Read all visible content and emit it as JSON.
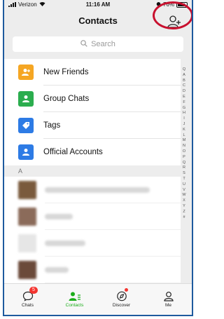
{
  "status": {
    "carrier": "Verizon",
    "time": "11:16 AM",
    "battery": "76%"
  },
  "nav": {
    "title": "Contacts"
  },
  "search": {
    "placeholder": "Search"
  },
  "menu": [
    {
      "label": "New Friends",
      "color": "#f5a623",
      "icon": "new-friends-icon"
    },
    {
      "label": "Group Chats",
      "color": "#2bad4e",
      "icon": "group-chats-icon"
    },
    {
      "label": "Tags",
      "color": "#2d7be5",
      "icon": "tags-icon"
    },
    {
      "label": "Official Accounts",
      "color": "#2d7be5",
      "icon": "official-accounts-icon"
    }
  ],
  "section_letter": "A",
  "index": [
    "Q",
    "A",
    "B",
    "C",
    "D",
    "E",
    "F",
    "G",
    "H",
    "I",
    "J",
    "K",
    "L",
    "M",
    "N",
    "O",
    "P",
    "Q",
    "R",
    "S",
    "T",
    "U",
    "V",
    "W",
    "X",
    "Y",
    "Z",
    "#"
  ],
  "tabs": [
    {
      "label": "Chats",
      "badge": "5"
    },
    {
      "label": "Contacts"
    },
    {
      "label": "Discover"
    },
    {
      "label": "Me"
    }
  ],
  "colors": {
    "accent": "#1aad19",
    "highlight": "#c8102e"
  }
}
